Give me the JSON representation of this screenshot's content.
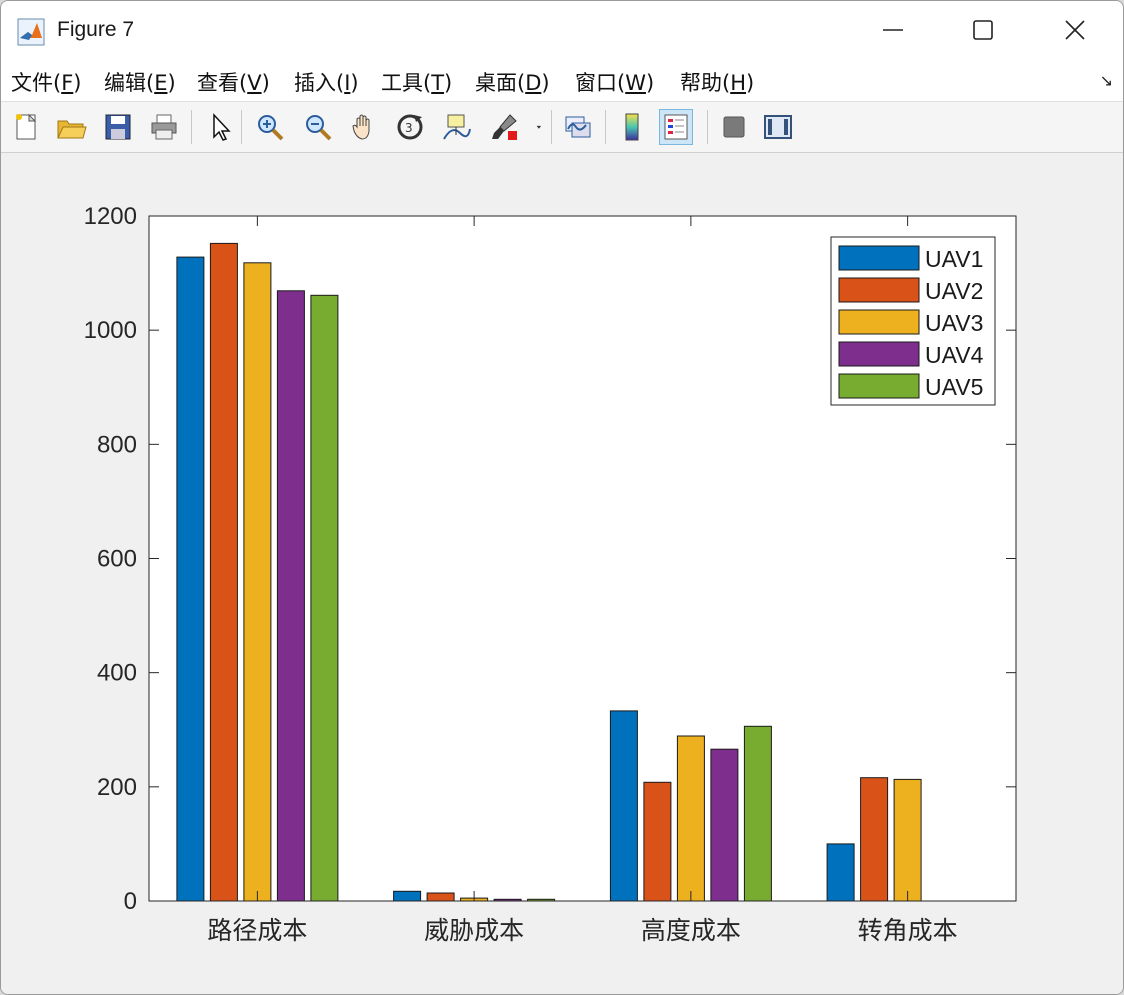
{
  "window": {
    "title": "Figure 7"
  },
  "menu": [
    {
      "label": "文件(F)",
      "pre": "文件(",
      "key": "F",
      "post": ")"
    },
    {
      "label": "编辑(E)",
      "pre": "编辑(",
      "key": "E",
      "post": ")"
    },
    {
      "label": "查看(V)",
      "pre": "查看(",
      "key": "V",
      "post": ")"
    },
    {
      "label": "插入(I)",
      "pre": "插入(",
      "key": "I",
      "post": ")"
    },
    {
      "label": "工具(T)",
      "pre": "工具(",
      "key": "T",
      "post": ")"
    },
    {
      "label": "桌面(D)",
      "pre": "桌面(",
      "key": "D",
      "post": ")"
    },
    {
      "label": "窗口(W)",
      "pre": "窗口(",
      "key": "W",
      "post": ")"
    },
    {
      "label": "帮助(H)",
      "pre": "帮助(",
      "key": "H",
      "post": ")"
    }
  ],
  "toolbar": [
    {
      "name": "new-figure-icon"
    },
    {
      "name": "open-file-icon"
    },
    {
      "name": "save-icon"
    },
    {
      "name": "print-icon"
    },
    {
      "name": "edit-plot-cursor-icon"
    },
    {
      "name": "zoom-in-icon"
    },
    {
      "name": "zoom-out-icon"
    },
    {
      "name": "pan-hand-icon"
    },
    {
      "name": "rotate-3d-icon"
    },
    {
      "name": "data-cursor-icon"
    },
    {
      "name": "brush-icon"
    },
    {
      "name": "brush-dropdown-icon"
    },
    {
      "name": "link-plot-icon"
    },
    {
      "name": "insert-colorbar-icon"
    },
    {
      "name": "insert-legend-icon",
      "active": true
    },
    {
      "name": "hide-plot-tools-icon"
    },
    {
      "name": "show-plot-tools-icon"
    }
  ],
  "chart_data": {
    "type": "bar",
    "categories": [
      "路径成本",
      "威胁成本",
      "高度成本",
      "转角成本"
    ],
    "series": [
      {
        "name": "UAV1",
        "color": "#0072BD",
        "values": [
          1128,
          17,
          333,
          100
        ]
      },
      {
        "name": "UAV2",
        "color": "#D95319",
        "values": [
          1152,
          14,
          208,
          216
        ]
      },
      {
        "name": "UAV3",
        "color": "#EDB120",
        "values": [
          1118,
          5,
          289,
          213
        ]
      },
      {
        "name": "UAV4",
        "color": "#7E2F8E",
        "values": [
          1069,
          3,
          266,
          0
        ]
      },
      {
        "name": "UAV5",
        "color": "#77AC30",
        "values": [
          1061,
          3,
          306,
          0
        ]
      }
    ],
    "yticks": [
      0,
      200,
      400,
      600,
      800,
      1000,
      1200
    ],
    "ylim": [
      0,
      1200
    ],
    "legend_position": "top-right",
    "grid": false
  }
}
